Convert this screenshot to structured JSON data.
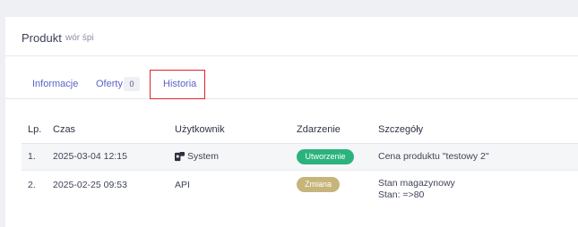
{
  "header": {
    "title": "Produkt",
    "subtitle": "wór śpi"
  },
  "tabs": [
    {
      "label": "Informacje"
    },
    {
      "label": "Oferty",
      "badge": "0"
    },
    {
      "label": "Historia"
    }
  ],
  "table": {
    "columns": [
      "Lp.",
      "Czas",
      "Użytkownik",
      "Zdarzenie",
      "Szczegóły"
    ],
    "rows": [
      {
        "lp": "1.",
        "time": "2025-03-04 12:15",
        "user": "System",
        "user_icon": "system-logo-icon",
        "event": "Utworzenie",
        "details": [
          "Cena produktu \"testowy 2\""
        ]
      },
      {
        "lp": "2.",
        "time": "2025-02-25 09:53",
        "user": "API",
        "event": "Zmiana",
        "details": [
          "Stan magazynowy",
          "Stan: =>80"
        ]
      }
    ]
  },
  "colors": {
    "accent": "#5b63c9",
    "highlight_border": "#e2232c",
    "event_created": "#2bb37d",
    "event_changed": "#c6b47a"
  }
}
